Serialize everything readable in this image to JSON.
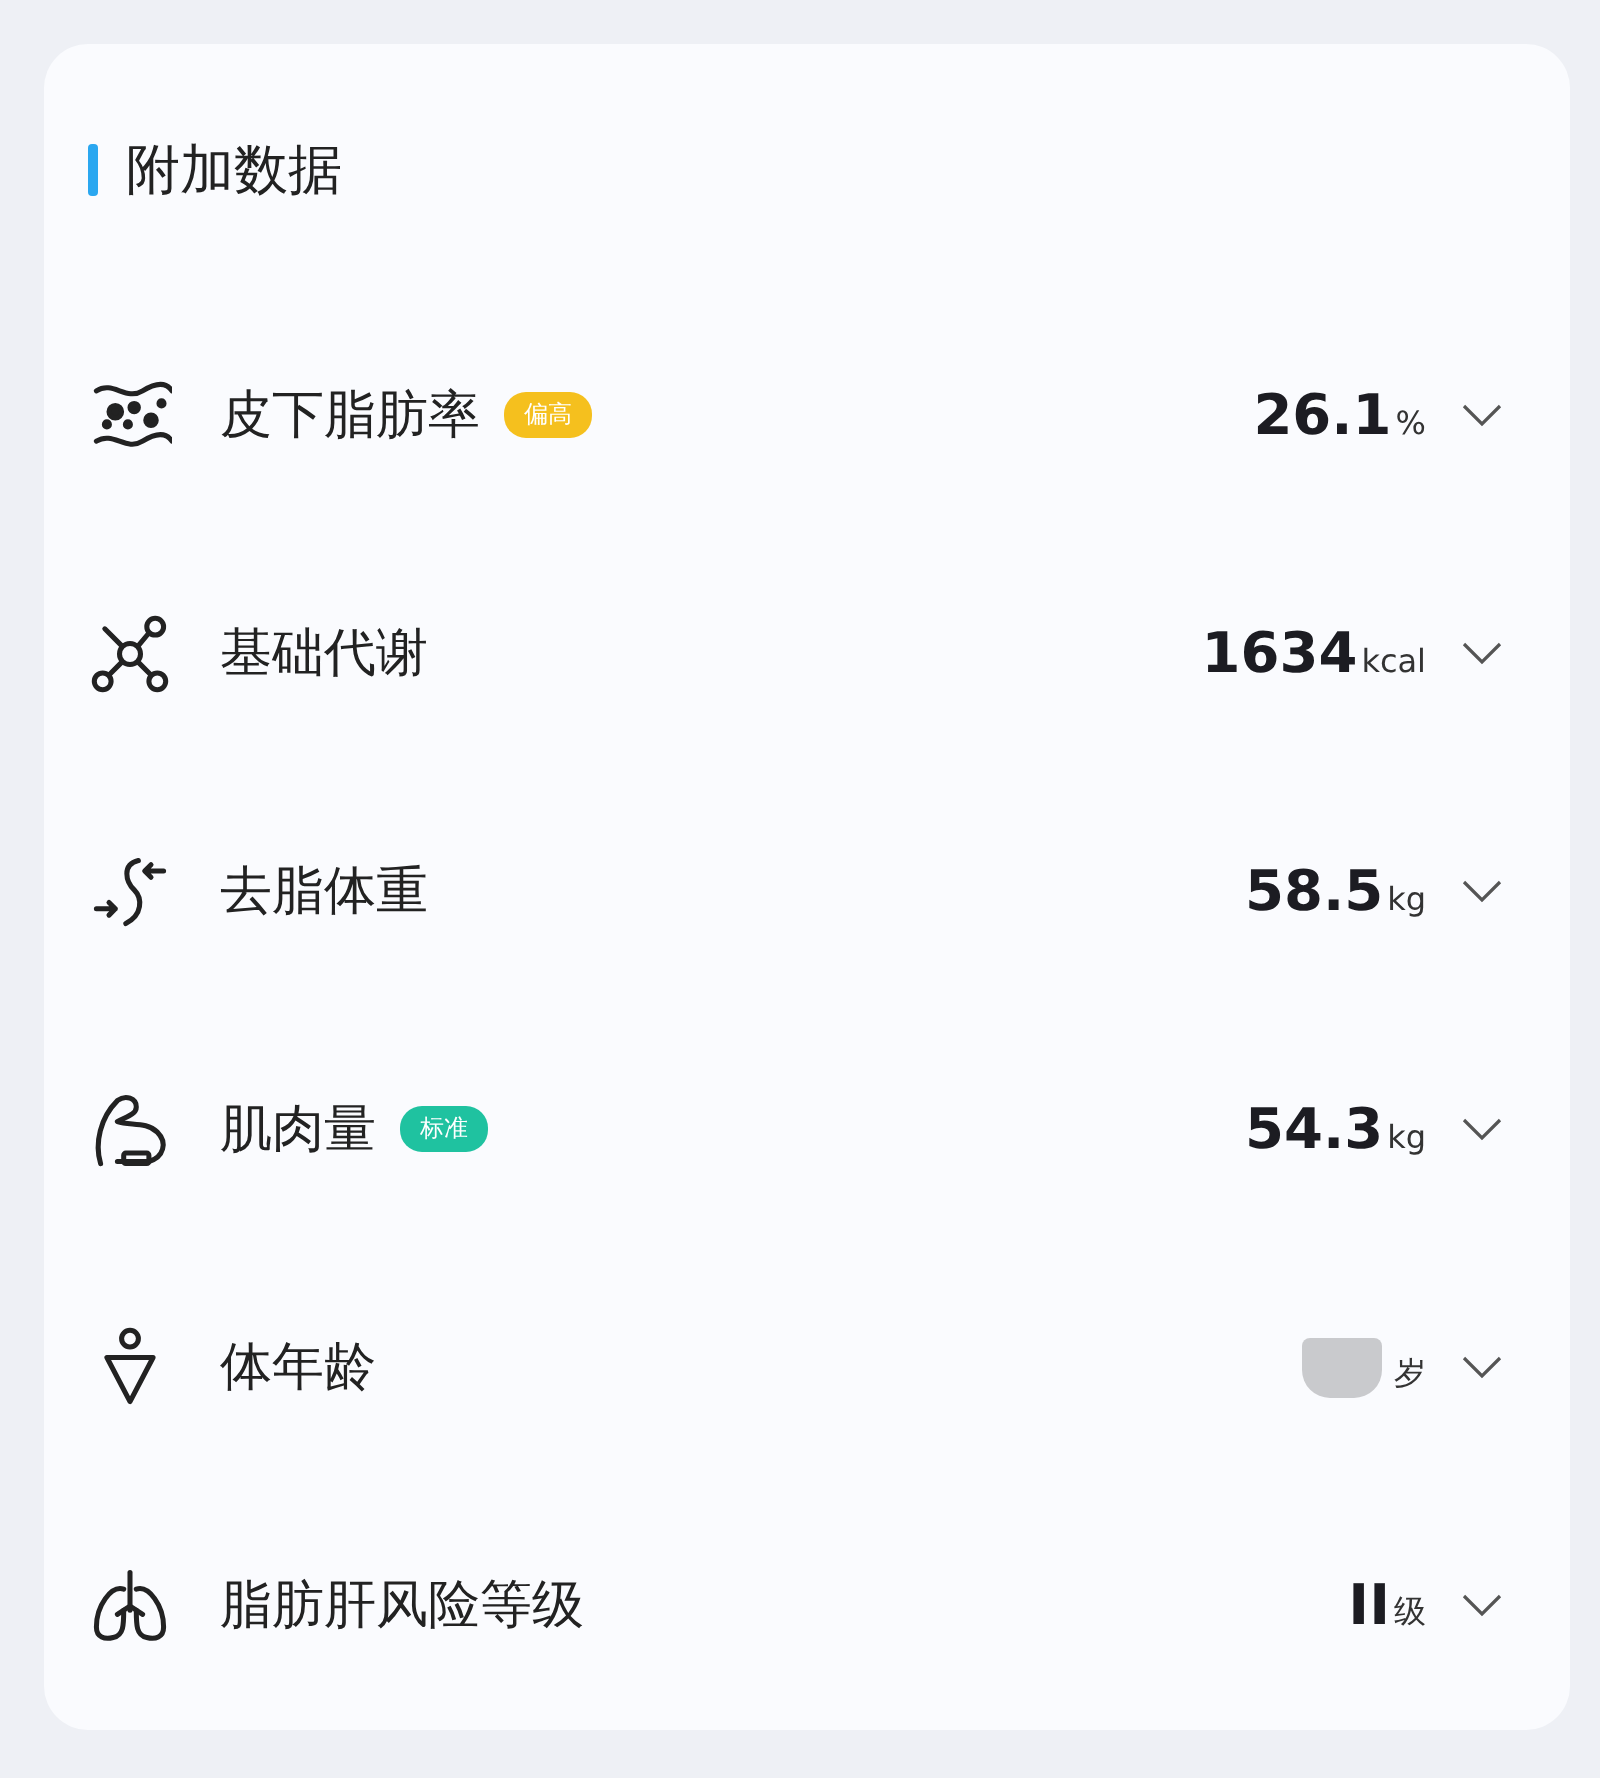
{
  "section": {
    "title": "附加数据"
  },
  "metrics": [
    {
      "label": "皮下脂肪率",
      "badge": {
        "text": "偏高",
        "color": "#f5c01e"
      },
      "value": "26.1",
      "unit": "%"
    },
    {
      "label": "基础代谢",
      "value": "1634",
      "unit": "kcal"
    },
    {
      "label": "去脂体重",
      "value": "58.5",
      "unit": "kg"
    },
    {
      "label": "肌肉量",
      "badge": {
        "text": "标准",
        "color": "#1fc2a0"
      },
      "value": "54.3",
      "unit": "kg"
    },
    {
      "label": "体年龄",
      "redacted": true,
      "unit": "岁"
    },
    {
      "label": "脂肪肝风险等级",
      "value": "II",
      "unit": "级"
    }
  ]
}
